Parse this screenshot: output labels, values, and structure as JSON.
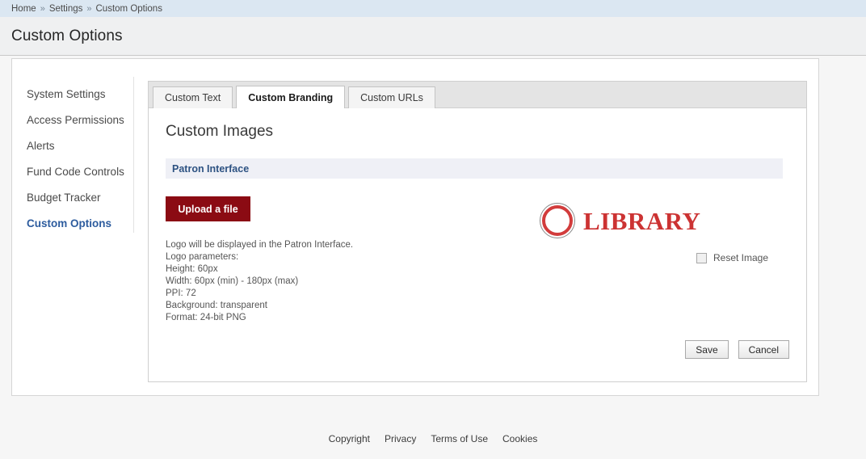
{
  "breadcrumb": {
    "separator": "»",
    "items": [
      {
        "label": "Home"
      },
      {
        "label": "Settings"
      },
      {
        "label": "Custom Options"
      }
    ]
  },
  "header": {
    "title": "Custom Options"
  },
  "sidebar": {
    "items": [
      {
        "label": "System Settings",
        "active": false
      },
      {
        "label": "Access Permissions",
        "active": false
      },
      {
        "label": "Alerts",
        "active": false
      },
      {
        "label": "Fund Code Controls",
        "active": false
      },
      {
        "label": "Budget Tracker",
        "active": false
      },
      {
        "label": "Custom Options",
        "active": true
      }
    ]
  },
  "tabs": [
    {
      "label": "Custom Text",
      "active": false
    },
    {
      "label": "Custom Branding",
      "active": true
    },
    {
      "label": "Custom URLs",
      "active": false
    }
  ],
  "main": {
    "heading": "Custom Images",
    "subsection": "Patron Interface",
    "upload_button": "Upload a file",
    "logo_params": [
      "Logo will be displayed in the Patron Interface.",
      "Logo parameters:",
      "Height: 60px",
      "Width: 60px (min) - 180px (max)",
      "PPI: 72",
      "Background: transparent",
      "Format: 24-bit PNG"
    ],
    "logo": {
      "text": "LIBRARY",
      "ring_color": "#d23c3c",
      "ring_outline_color": "#8a8a8a",
      "text_color": "#cc3333"
    },
    "reset_image_label": "Reset Image",
    "reset_image_checked": false,
    "save_label": "Save",
    "cancel_label": "Cancel"
  },
  "footer": {
    "links": [
      {
        "label": "Copyright"
      },
      {
        "label": "Privacy"
      },
      {
        "label": "Terms of Use"
      },
      {
        "label": "Cookies"
      }
    ]
  },
  "colors": {
    "breadcrumb_bar": "#dbe7f2",
    "page_header": "#eff0f1",
    "accent_red": "#8b0b13",
    "accent_blue": "#2d5c9e",
    "subsection_bar": "#eff0f6"
  }
}
